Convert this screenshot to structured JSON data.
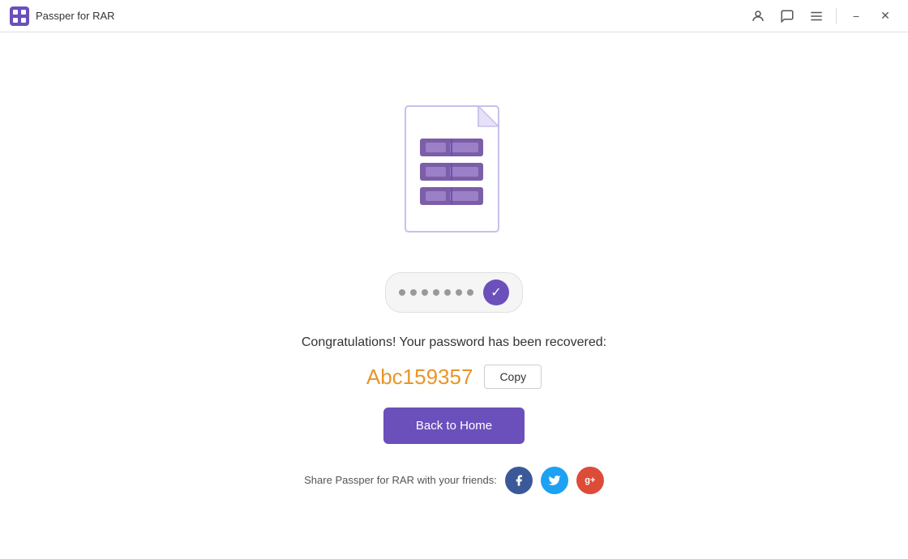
{
  "titlebar": {
    "app_name": "Passper for RAR",
    "app_icon": "grid-icon"
  },
  "main": {
    "congratulations_text": "Congratulations! Your password has been recovered:",
    "password_value": "Abc159357",
    "copy_button_label": "Copy",
    "back_button_label": "Back to Home",
    "share_text": "Share Passper for RAR with your friends:",
    "dots_count": 7
  },
  "social": {
    "facebook_label": "f",
    "twitter_label": "t",
    "googleplus_label": "g+"
  },
  "window": {
    "minimize_label": "−",
    "close_label": "✕"
  }
}
